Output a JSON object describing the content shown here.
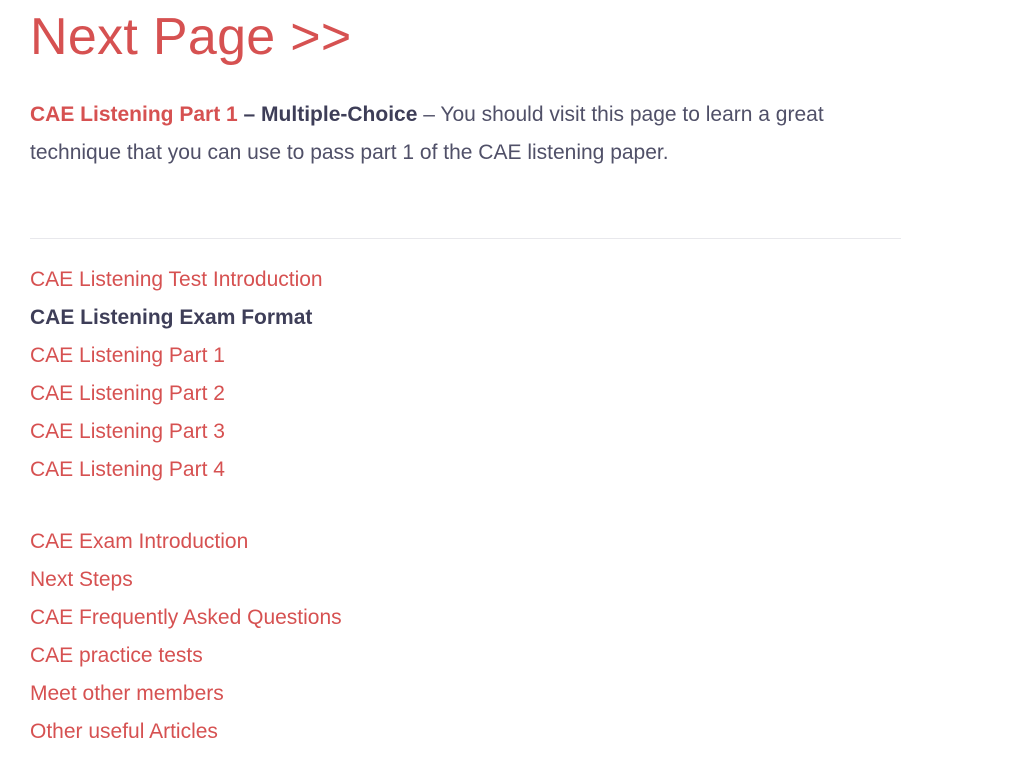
{
  "heading": "Next Page >>",
  "intro": {
    "link_text": "CAE Listening Part 1",
    "bold_text": " – Multiple-Choice",
    "body_text": " – You should visit this page to learn a great technique that you can use to pass part 1 of the CAE listening paper."
  },
  "listening_nav": [
    {
      "label": "CAE Listening Test Introduction",
      "current": false
    },
    {
      "label": "CAE Listening Exam Format",
      "current": true
    },
    {
      "label": "CAE Listening Part 1",
      "current": false
    },
    {
      "label": "CAE Listening Part 2",
      "current": false
    },
    {
      "label": "CAE Listening Part 3",
      "current": false
    },
    {
      "label": "CAE Listening Part 4",
      "current": false
    }
  ],
  "general_nav": [
    {
      "label": "CAE Exam Introduction"
    },
    {
      "label": "Next Steps"
    },
    {
      "label": "CAE Frequently Asked Questions"
    },
    {
      "label": "CAE practice tests"
    },
    {
      "label": "Meet other members"
    },
    {
      "label": "Other useful Articles"
    }
  ],
  "colors": {
    "accent": "#d65151",
    "text": "#505068",
    "strong": "#3e3e58",
    "divider": "#e8e8ec"
  }
}
